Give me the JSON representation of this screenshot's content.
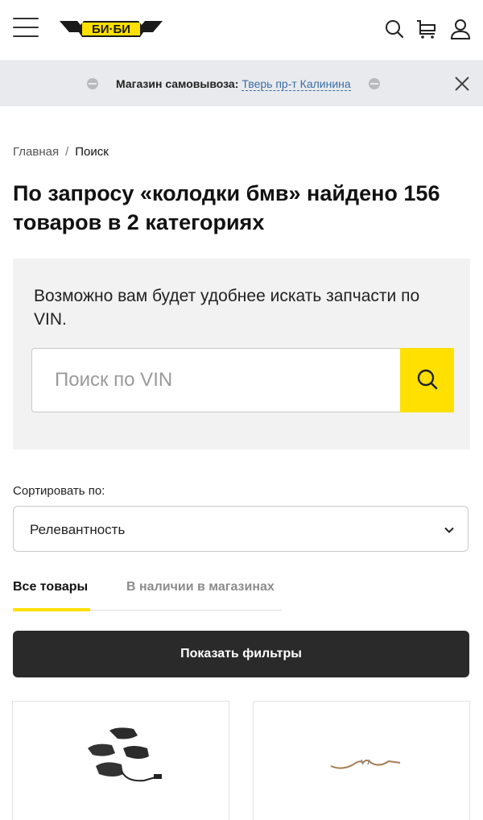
{
  "header": {
    "logo_text": "БИ·БИ",
    "menu_icon": "hamburger-menu-icon",
    "search_icon": "search-icon",
    "cart_icon": "cart-icon",
    "user_icon": "user-icon",
    "brand_color": "#ffe000"
  },
  "store_bar": {
    "label": "Магазин самовывоза:",
    "store": "Тверь пр-т Калинина",
    "close_icon": "close-icon"
  },
  "breadcrumb": {
    "home": "Главная",
    "separator": "/",
    "current": "Поиск"
  },
  "title": "По запросу «колодки бмв» найдено 156 товаров в 2 категориях",
  "vin": {
    "text": "Возможно вам будет удобнее искать запчасти по VIN.",
    "placeholder": "Поиск по VIN",
    "value": "",
    "button_icon": "search-icon"
  },
  "sort": {
    "label": "Сортировать по:",
    "selected": "Релевантность"
  },
  "tabs": [
    {
      "label": "Все товары",
      "active": true
    },
    {
      "label": "В наличии в магазинах",
      "active": false
    }
  ],
  "filters_button": "Показать фильтры",
  "products": [
    {
      "image": "brake-pads-set-image"
    },
    {
      "image": "wear-sensor-wire-image"
    }
  ]
}
